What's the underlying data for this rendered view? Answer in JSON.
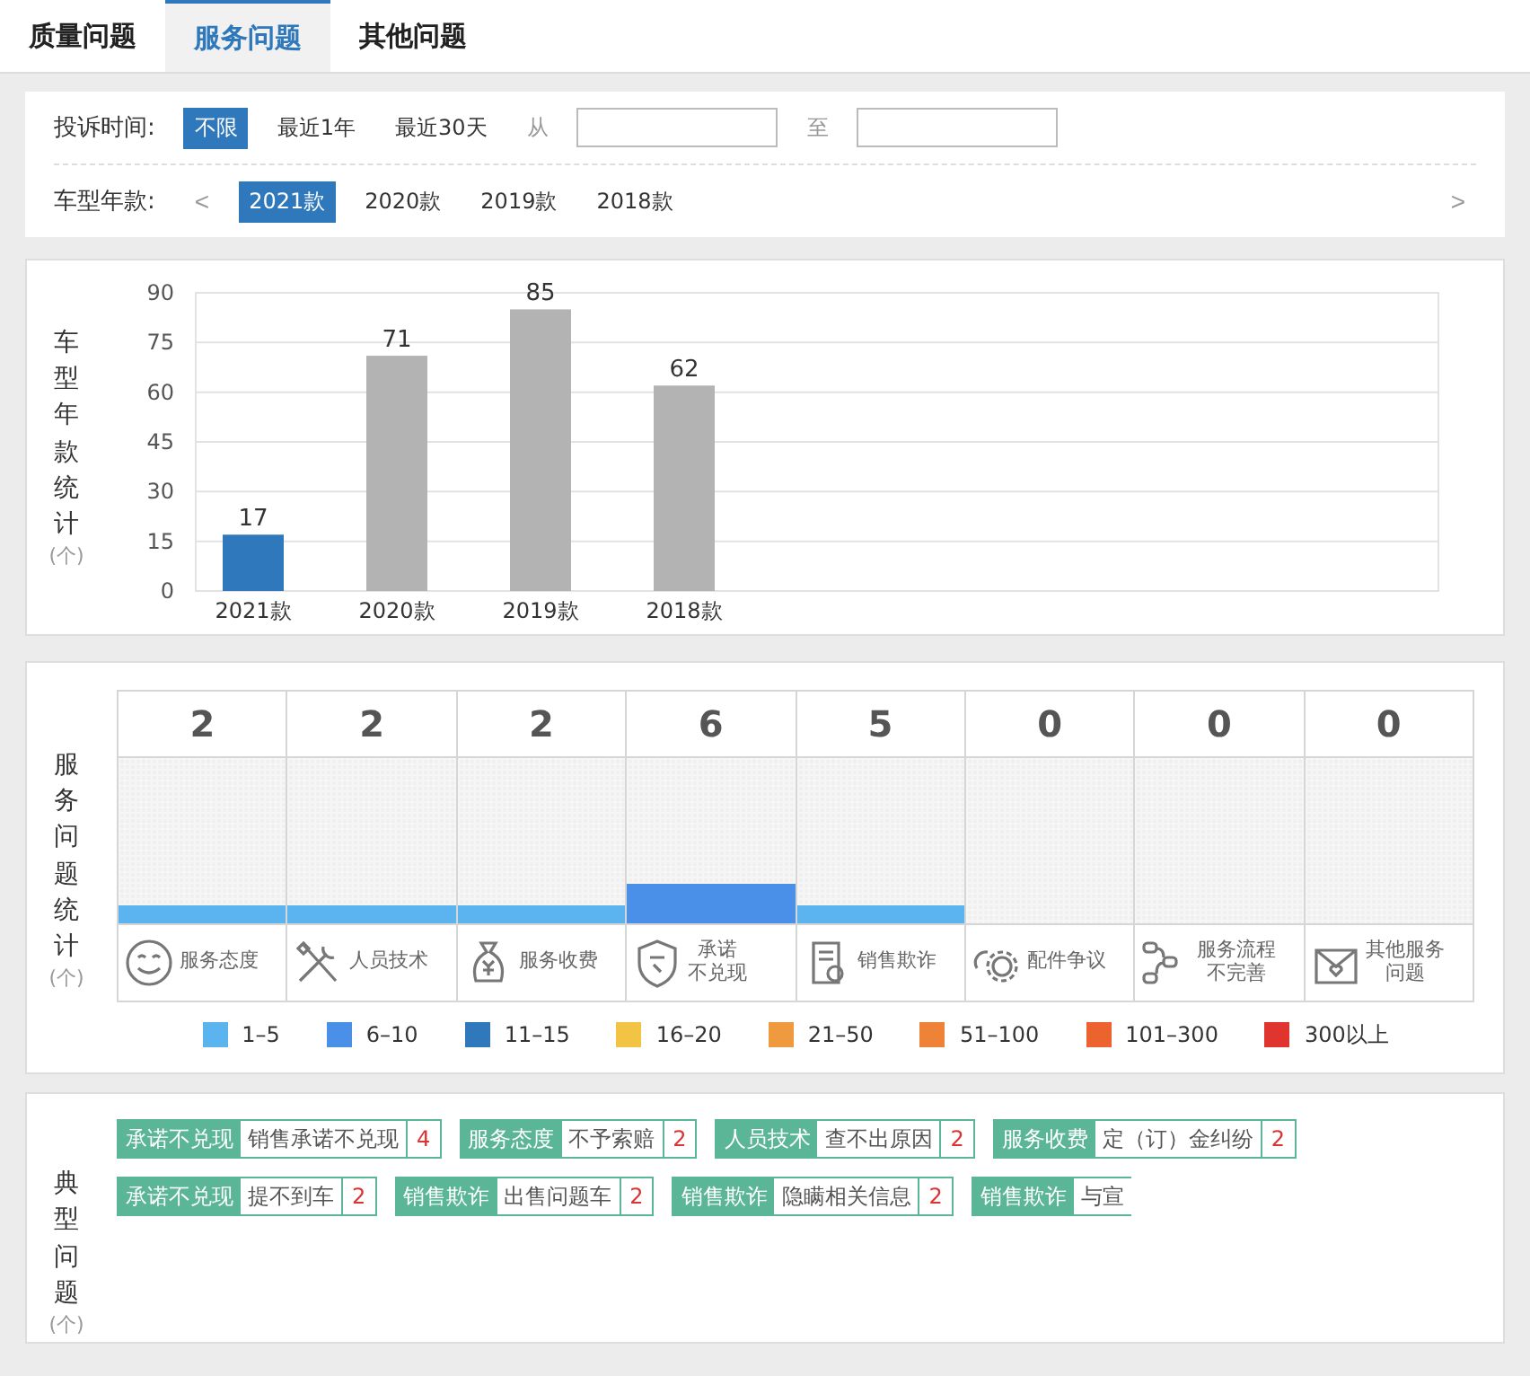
{
  "tabs": [
    {
      "label": "质量问题",
      "selected": false
    },
    {
      "label": "服务问题",
      "selected": true
    },
    {
      "label": "其他问题",
      "selected": false
    }
  ],
  "filters": {
    "time": {
      "label": "投诉时间:",
      "options": [
        {
          "label": "不限",
          "selected": true
        },
        {
          "label": "最近1年",
          "selected": false
        },
        {
          "label": "最近30天",
          "selected": false
        }
      ],
      "from_label": "从",
      "to_label": "至"
    },
    "year": {
      "label": "车型年款:",
      "prev": "<",
      "next": ">",
      "options": [
        {
          "label": "2021款",
          "selected": true
        },
        {
          "label": "2020款",
          "selected": false
        },
        {
          "label": "2019款",
          "selected": false
        },
        {
          "label": "2018款",
          "selected": false
        }
      ]
    }
  },
  "year_stats": {
    "title": "车型年款统计",
    "unit": "(个)",
    "chart_data": {
      "type": "bar",
      "categories": [
        "2021款",
        "2020款",
        "2019款",
        "2018款"
      ],
      "values": [
        17,
        71,
        85,
        62
      ],
      "ylim": [
        0,
        90
      ],
      "yticks": [
        0,
        15,
        30,
        45,
        60,
        75,
        90
      ],
      "grid": true,
      "data_labels": true
    }
  },
  "service_stats": {
    "title": "服务问题统计",
    "unit": "(个)",
    "columns": [
      {
        "count": "2",
        "label_lines": [
          "服务态度"
        ],
        "kind": "smile",
        "color": "#5bb3f0"
      },
      {
        "count": "2",
        "label_lines": [
          "人员技术"
        ],
        "kind": "tools",
        "color": "#5bb3f0"
      },
      {
        "count": "2",
        "label_lines": [
          "服务收费"
        ],
        "kind": "money",
        "color": "#5bb3f0"
      },
      {
        "count": "6",
        "label_lines": [
          "承诺",
          "不兑现"
        ],
        "kind": "shield",
        "color": "#4a90e8"
      },
      {
        "count": "5",
        "label_lines": [
          "销售欺诈"
        ],
        "kind": "document",
        "color": "#5bb3f0"
      },
      {
        "count": "0",
        "label_lines": [
          "配件争议"
        ],
        "kind": "gears"
      },
      {
        "count": "0",
        "label_lines": [
          "服务流程",
          "不完善"
        ],
        "kind": "flow"
      },
      {
        "count": "0",
        "label_lines": [
          "其他服务",
          "问题"
        ],
        "kind": "box"
      }
    ],
    "legend": [
      {
        "label": "1–5",
        "color": "#5bb3f0"
      },
      {
        "label": "6–10",
        "color": "#4a90e8"
      },
      {
        "label": "11–15",
        "color": "#2f78bb"
      },
      {
        "label": "16–20",
        "color": "#f3c343"
      },
      {
        "label": "21–50",
        "color": "#ef9a3e"
      },
      {
        "label": "51–100",
        "color": "#ee8237"
      },
      {
        "label": "101–300",
        "color": "#ec6330"
      },
      {
        "label": "300以上",
        "color": "#e0352f"
      }
    ]
  },
  "typical": {
    "title": "典型问题",
    "unit": "(个)",
    "tags": [
      {
        "category": "承诺不兑现",
        "issue": "销售承诺不兑现",
        "count": "4"
      },
      {
        "category": "服务态度",
        "issue": "不予索赔",
        "count": "2"
      },
      {
        "category": "人员技术",
        "issue": "查不出原因",
        "count": "2"
      },
      {
        "category": "服务收费",
        "issue": "定（订）金纠纷",
        "count": "2"
      },
      {
        "category": "承诺不兑现",
        "issue": "提不到车",
        "count": "2"
      },
      {
        "category": "销售欺诈",
        "issue": "出售问题车",
        "count": "2"
      },
      {
        "category": "销售欺诈",
        "issue": "隐瞒相关信息",
        "count": "2"
      },
      {
        "category": "销售欺诈",
        "issue": "与宣"
      }
    ]
  }
}
